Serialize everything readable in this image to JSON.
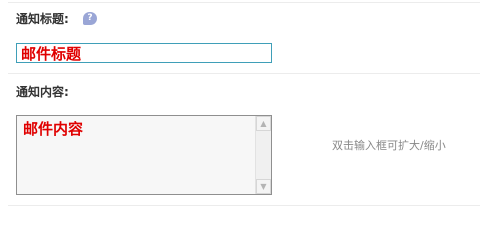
{
  "notice_title": {
    "label": "通知标题:",
    "help_icon": "question-bubble-icon",
    "input_value": "邮件标题"
  },
  "notice_content": {
    "label": "通知内容:",
    "textarea_value": "邮件内容",
    "hint": "双击输入框可扩大/缩小",
    "scroll_up_icon": "triangle-up-icon",
    "scroll_down_icon": "triangle-down-icon"
  },
  "colors": {
    "value_text": "#e00000",
    "input_border": "#3f9fb8",
    "help_icon_bg": "#9aa6d6"
  }
}
